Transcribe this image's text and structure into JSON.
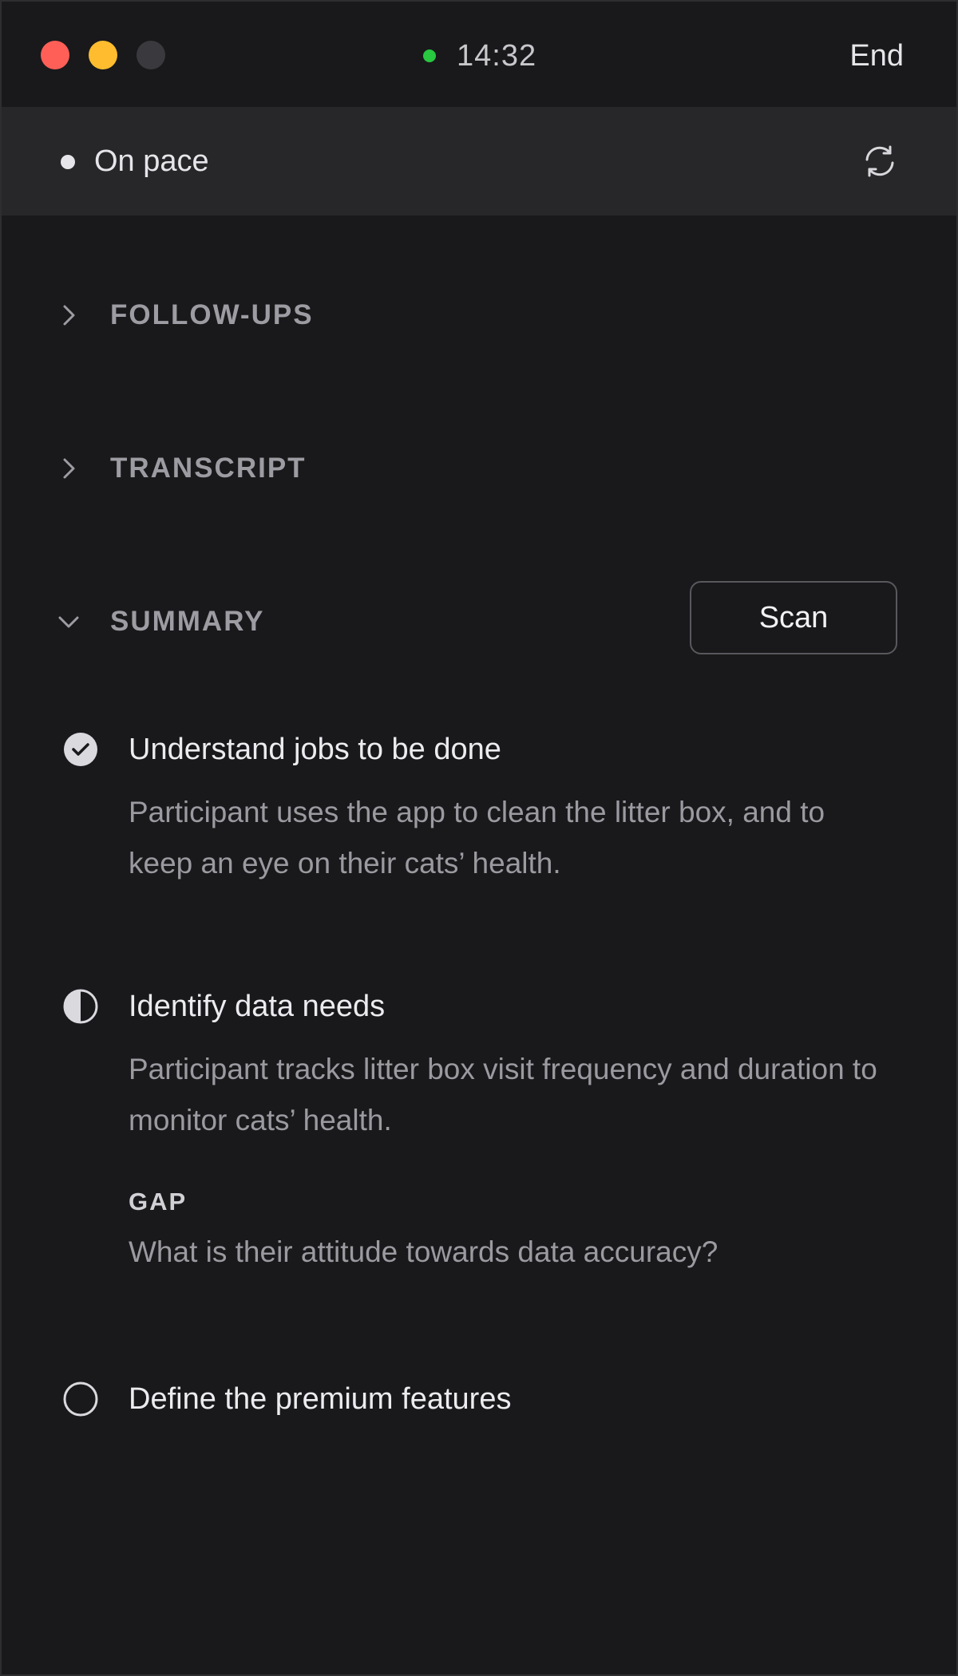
{
  "titlebar": {
    "timer": "14:32",
    "end_label": "End",
    "live_color": "#28c840"
  },
  "status": {
    "text": "On pace"
  },
  "sections": {
    "followups": {
      "title": "FOLLOW-UPS",
      "expanded": false
    },
    "transcript": {
      "title": "TRANSCRIPT",
      "expanded": false
    },
    "summary": {
      "title": "SUMMARY",
      "expanded": true,
      "scan_label": "Scan"
    }
  },
  "goals": [
    {
      "status": "complete",
      "title": "Understand jobs to be done",
      "description": "Participant uses the app to clean the litter box, and to keep an eye on their cats’ health."
    },
    {
      "status": "partial",
      "title": "Identify data needs",
      "description": "Participant tracks litter box visit frequency and duration to monitor cats’ health.",
      "gap_label": "GAP",
      "gap_text": "What is their attitude towards data accuracy?"
    },
    {
      "status": "not-started",
      "title": "Define the premium features"
    }
  ]
}
